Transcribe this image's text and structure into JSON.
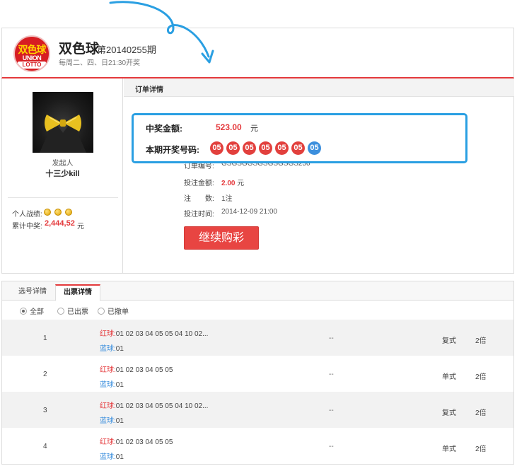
{
  "header": {
    "logo_line1": "双色球",
    "logo_line2": "UNION",
    "logo_line3": "LOTTO",
    "lottery_name": "双色球",
    "issue": "第20140255期",
    "schedule": "每周二、四、日21:30开奖"
  },
  "initiator": {
    "label": "发起人",
    "name": "十三少kill",
    "record_label": "个人战绩:",
    "total_label": "累计中奖:",
    "total_value": "2,444,52",
    "total_unit": "元"
  },
  "order": {
    "section_title": "订单详情",
    "prize_label": "中奖金额:",
    "prize_amount": "523.00",
    "prize_unit": "元",
    "numbers_label": "本期开奖号码:",
    "winning_numbers": {
      "red": [
        "05",
        "05",
        "05",
        "05",
        "05",
        "05"
      ],
      "blue": [
        "05"
      ]
    },
    "order_no_label": "订单编号:",
    "order_no": "GSGSGGSGSGSGSGS250",
    "bet_amount_label": "投注金额:",
    "bet_amount": "2.00",
    "bet_amount_unit": "元",
    "notes_label": "注　　数:",
    "notes_value": "1注",
    "bet_time_label": "投注时间:",
    "bet_time": "2014-12-09 21:00",
    "continue_button": "继续购彩"
  },
  "tabs": [
    {
      "label": "选号详情",
      "active": false
    },
    {
      "label": "出票详情",
      "active": true
    }
  ],
  "filters": [
    {
      "label": "全部",
      "checked": true
    },
    {
      "label": "已出票",
      "checked": false
    },
    {
      "label": "已撤单",
      "checked": false
    }
  ],
  "tickets": [
    {
      "index": "1",
      "red_label": "红球:",
      "red": "01 02 03 04 05 05 04 10 02...",
      "blue_label": "蓝球:",
      "blue": "01",
      "status": "--",
      "type": "复式",
      "multiple": "2倍"
    },
    {
      "index": "2",
      "red_label": "红球:",
      "red": "01 02 03 04 05 05",
      "blue_label": "蓝球:",
      "blue": "01",
      "status": "--",
      "type": "单式",
      "multiple": "2倍"
    },
    {
      "index": "3",
      "red_label": "红球:",
      "red": "01 02 03 04 05 05 04 10 02...",
      "blue_label": "蓝球:",
      "blue": "01",
      "status": "--",
      "type": "复式",
      "multiple": "2倍"
    },
    {
      "index": "4",
      "red_label": "红球:",
      "red": "01 02 03 04 05 05",
      "blue_label": "蓝球:",
      "blue": "01",
      "status": "--",
      "type": "单式",
      "multiple": "2倍"
    }
  ],
  "colors": {
    "accent_red": "#e4393c",
    "highlight_blue": "#2a9fe2",
    "blue_ball": "#3c8fdd"
  }
}
